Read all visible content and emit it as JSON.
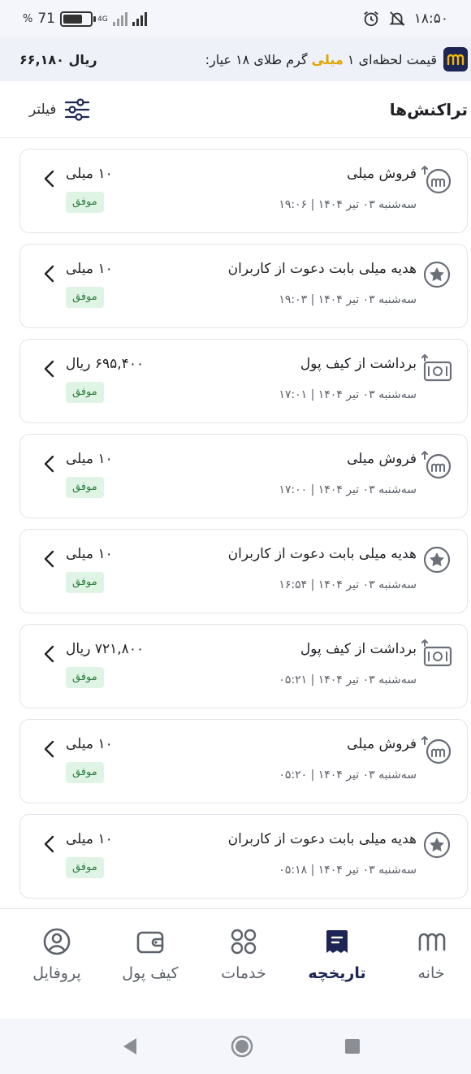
{
  "status_bar": {
    "time": "۱۸:۵۰",
    "battery_text": "71",
    "battery_suffix": "%",
    "battery_level": 0.71,
    "network": "4G"
  },
  "price_banner": {
    "value": "۶۶,۱۸۰ ریال",
    "label_prefix": "قیمت لحظه‌ای ۱",
    "label_highlight": "میلی",
    "label_suffix": "گرم طلای ۱۸ عیار:"
  },
  "header": {
    "title": "تراکنش‌ها",
    "filter_label": "فیلتر"
  },
  "transactions": [
    {
      "icon": "milli-sell-icon",
      "title": "فروش میلی",
      "date": "سه‌شنبه ۰۳ تیر ۱۴۰۴ | ۱۹:۰۶",
      "amount": "۱۰ میلی",
      "status": "موفق"
    },
    {
      "icon": "star-gift-icon",
      "title": "هدیه میلی بابت دعوت از کاربران",
      "date": "سه‌شنبه ۰۳ تیر ۱۴۰۴ | ۱۹:۰۳",
      "amount": "۱۰ میلی",
      "status": "موفق"
    },
    {
      "icon": "cash-withdraw-icon",
      "title": "برداشت از کیف پول",
      "date": "سه‌شنبه ۰۳ تیر ۱۴۰۴ | ۱۷:۰۱",
      "amount": "۶۹۵,۴۰۰ ریال",
      "status": "موفق"
    },
    {
      "icon": "milli-sell-icon",
      "title": "فروش میلی",
      "date": "سه‌شنبه ۰۳ تیر ۱۴۰۴ | ۱۷:۰۰",
      "amount": "۱۰ میلی",
      "status": "موفق"
    },
    {
      "icon": "star-gift-icon",
      "title": "هدیه میلی بابت دعوت از کاربران",
      "date": "سه‌شنبه ۰۳ تیر ۱۴۰۴ | ۱۶:۵۴",
      "amount": "۱۰ میلی",
      "status": "موفق"
    },
    {
      "icon": "cash-withdraw-icon",
      "title": "برداشت از کیف پول",
      "date": "سه‌شنبه ۰۳ تیر ۱۴۰۴ | ۰۵:۲۱",
      "amount": "۷۲۱,۸۰۰ ریال",
      "status": "موفق"
    },
    {
      "icon": "milli-sell-icon",
      "title": "فروش میلی",
      "date": "سه‌شنبه ۰۳ تیر ۱۴۰۴ | ۰۵:۲۰",
      "amount": "۱۰ میلی",
      "status": "موفق"
    },
    {
      "icon": "star-gift-icon",
      "title": "هدیه میلی بابت دعوت از کاربران",
      "date": "سه‌شنبه ۰۳ تیر ۱۴۰۴ | ۰۵:۱۸",
      "amount": "۱۰ میلی",
      "status": "موفق"
    }
  ],
  "bottom_nav": {
    "items": [
      {
        "label": "خانه",
        "icon": "home-logo-icon"
      },
      {
        "label": "تاریخچه",
        "icon": "history-icon",
        "active": true
      },
      {
        "label": "خدمات",
        "icon": "services-grid-icon"
      },
      {
        "label": "کیف پول",
        "icon": "wallet-icon"
      },
      {
        "label": "پروفایل",
        "icon": "profile-icon"
      }
    ]
  },
  "colors": {
    "brand": "#1c2553",
    "highlight": "#e0a500",
    "success_bg": "#dff4e4",
    "success_text": "#2e7d42"
  }
}
